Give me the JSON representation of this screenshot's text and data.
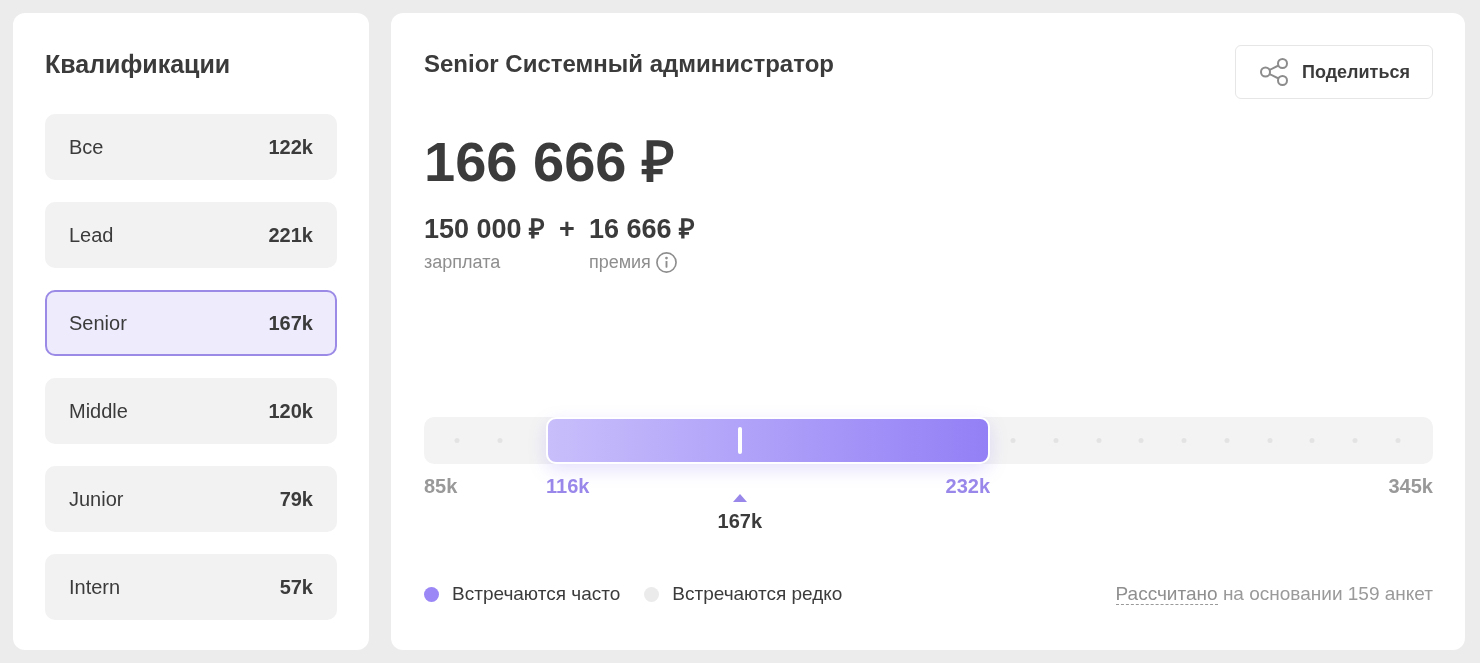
{
  "qualifications": {
    "title": "Квалификации",
    "items": [
      {
        "label": "Все",
        "value": "122k",
        "selected": false
      },
      {
        "label": "Lead",
        "value": "221k",
        "selected": false
      },
      {
        "label": "Senior",
        "value": "167k",
        "selected": true
      },
      {
        "label": "Middle",
        "value": "120k",
        "selected": false
      },
      {
        "label": "Junior",
        "value": "79k",
        "selected": false
      },
      {
        "label": "Intern",
        "value": "57k",
        "selected": false
      }
    ]
  },
  "position": {
    "title": "Senior Системный администратор",
    "share_button": "Поделиться",
    "total": "166 666 ₽",
    "salary": {
      "amount": "150 000 ₽",
      "label": "зарплата"
    },
    "operator": "+",
    "bonus": {
      "amount": "16 666 ₽",
      "label": "премия"
    }
  },
  "salary_scale": {
    "min_label": "85k",
    "max_label": "345k",
    "range_from": {
      "label": "116k",
      "level": 0.121
    },
    "range_to": {
      "label": "232k",
      "level": 0.561
    },
    "median": {
      "label": "167k",
      "level": 0.313
    }
  },
  "legend": [
    {
      "label": "Встречаются часто",
      "color": "#9b87f5"
    },
    {
      "label": "Встречаются редко",
      "color": "#ebebeb"
    }
  ],
  "footnote": {
    "link": "Рассчитано",
    "text": "на основании 159 анкет"
  }
}
